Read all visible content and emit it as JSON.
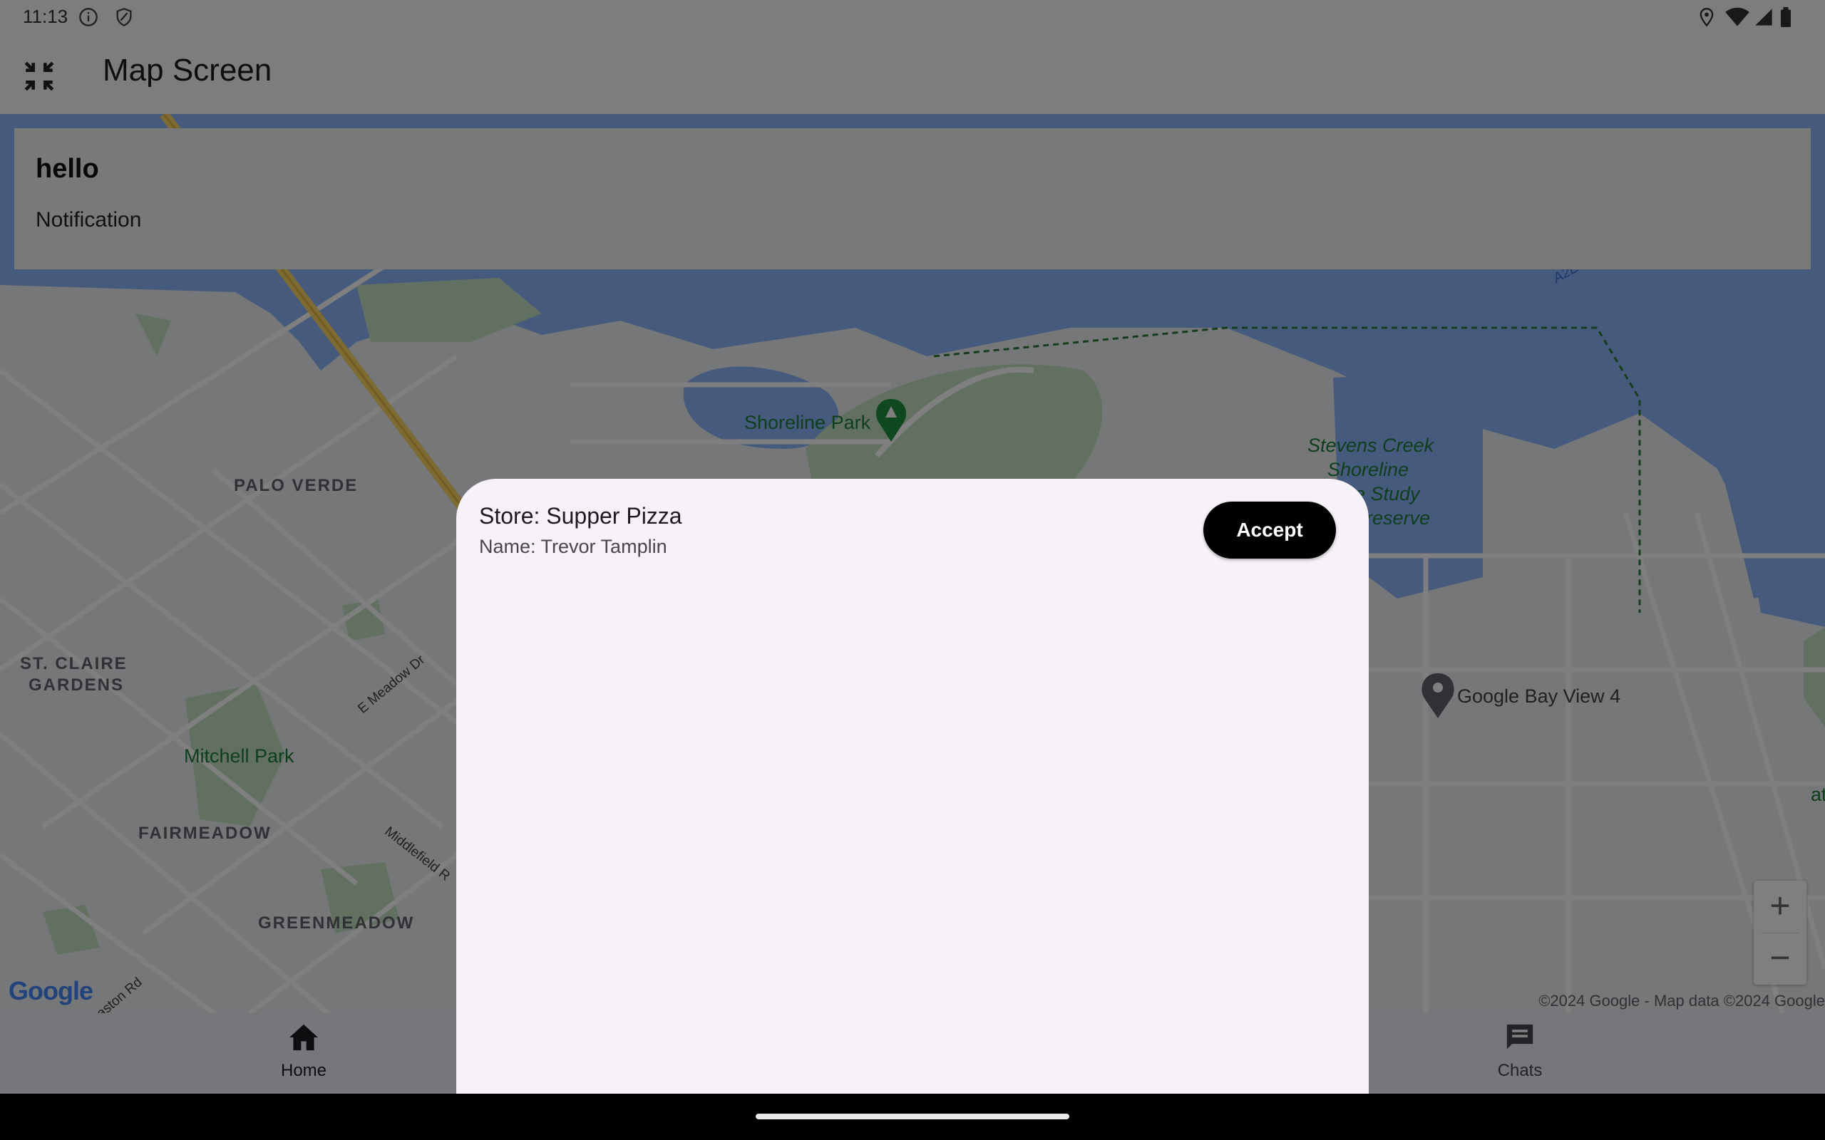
{
  "status_bar": {
    "time": "11:13"
  },
  "app_bar": {
    "title": "Map Screen"
  },
  "notification": {
    "title": "hello",
    "subtitle": "Notification"
  },
  "map": {
    "labels": {
      "palo_verde": "PALO VERDE",
      "st_claire_1": "ST. CLAIRE",
      "st_claire_2": "GARDENS",
      "mitchell_park": "Mitchell Park",
      "fairmeadow": "FAIRMEADOW",
      "greenmeadow": "GREENMEADOW",
      "shoreline_park": "Shoreline Park",
      "stevens_1": "Stevens Creek",
      "stevens_2": "Shoreline",
      "stevens_3": "e Study",
      "stevens_4": "reserve",
      "google_bay_view": "Google Bay View 4",
      "e_meadow_dr": "E Meadow Dr",
      "middlefield_rd": "Middlefield R",
      "route": "A2E",
      "edge_right": "at",
      "road_bottom": "aston Rd"
    },
    "google_logo": "Google",
    "copyright": "©2024 Google - Map data ©2024 Google",
    "zoom_in": "+",
    "zoom_out": "−"
  },
  "bottom_nav": {
    "home": "Home",
    "chats": "Chats"
  },
  "sheet": {
    "store": "Store: Supper Pizza",
    "name": "Name: Trevor Tamplin",
    "accept": "Accept"
  },
  "colors": {
    "water": "#8ab4f8",
    "park": "#c5e1c5",
    "road_major": "#f9d66b",
    "scrim": "rgba(0,0,0,0.5)",
    "sheet_bg": "#f6f2f8",
    "accept_bg": "#000000"
  }
}
